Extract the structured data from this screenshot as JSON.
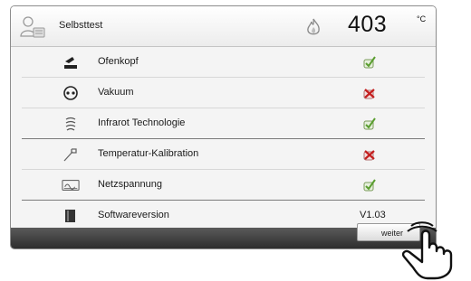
{
  "header": {
    "title": "Selbsttest",
    "temperature": "403",
    "unit": "°C",
    "icons": {
      "user": "user-icon",
      "flame": "flame-icon"
    }
  },
  "tests": [
    {
      "label": "Ofenkopf",
      "icon": "furnace-head-icon",
      "status": "ok"
    },
    {
      "label": "Vakuum",
      "icon": "vacuum-icon",
      "status": "error"
    },
    {
      "label": "Infrarot Technologie",
      "icon": "infrared-icon",
      "status": "ok"
    },
    {
      "label": "Temperatur-Kalibration",
      "icon": "calibration-probe-icon",
      "status": "error"
    },
    {
      "label": "Netzspannung",
      "icon": "voltage-icon",
      "status": "ok"
    },
    {
      "label": "Softwareversion",
      "icon": "software-chip-icon",
      "value": "V1.03"
    }
  ],
  "footer": {
    "button_label": "weiter"
  },
  "colors": {
    "ok": "#5a9e2f",
    "error": "#c41e1e",
    "footer": "#3c3c3c"
  }
}
